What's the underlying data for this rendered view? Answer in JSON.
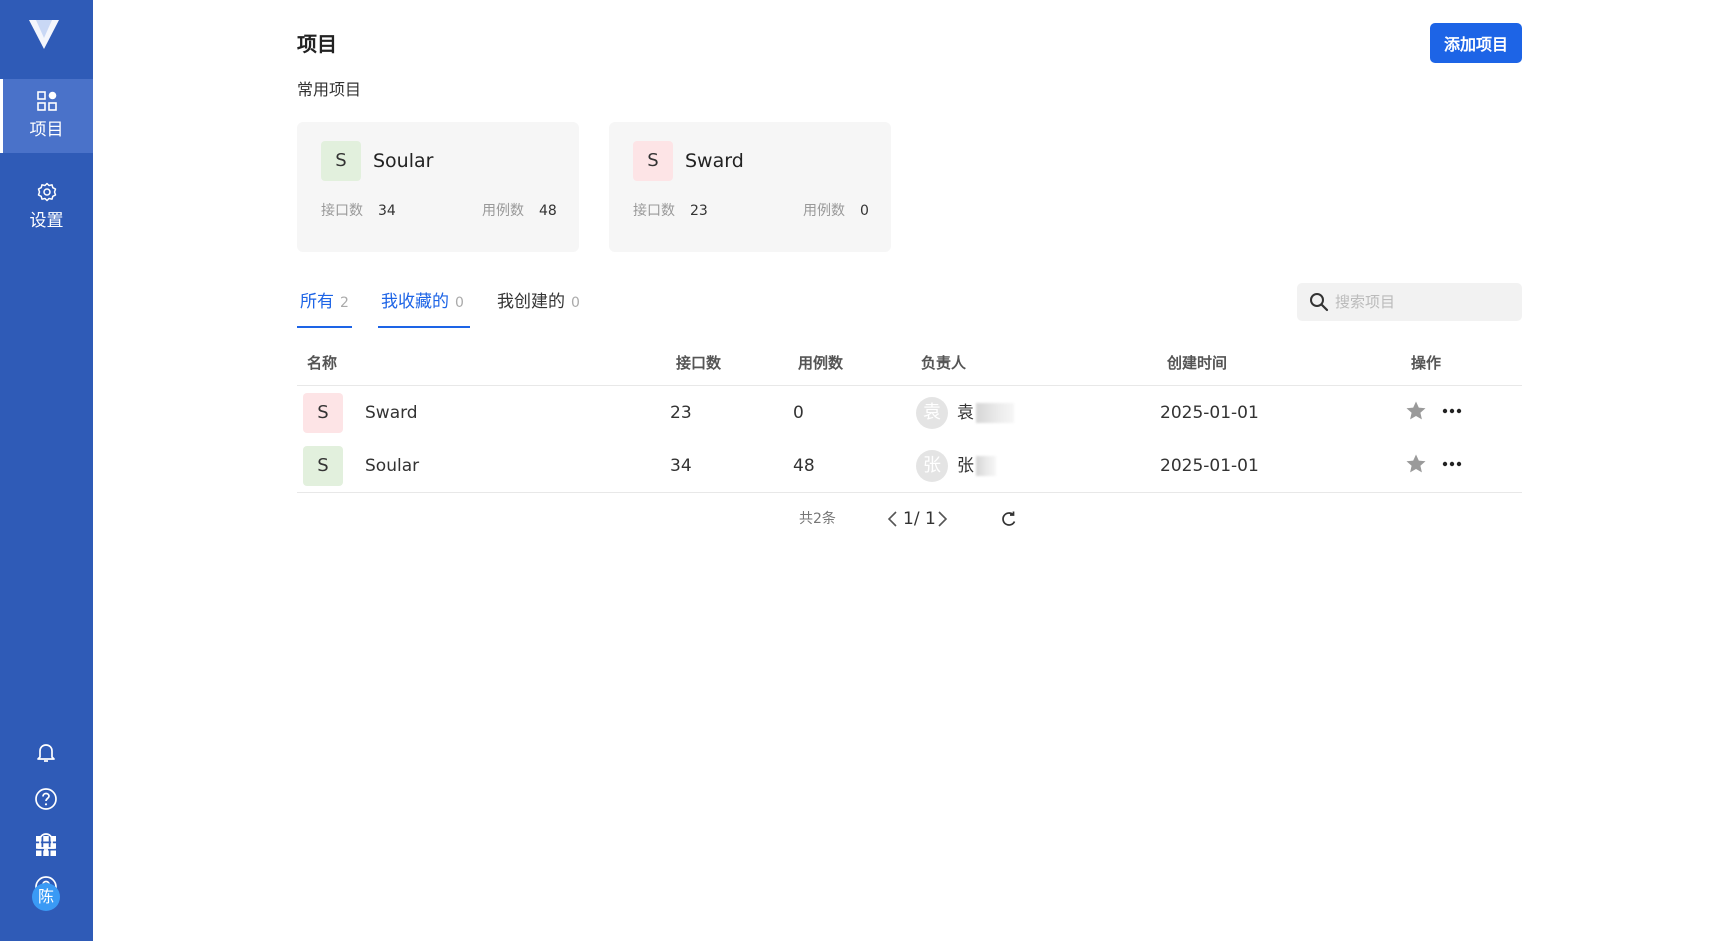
{
  "sidebar": {
    "nav": [
      {
        "label": "项目",
        "icon": "project-grid-icon",
        "active": true
      },
      {
        "label": "设置",
        "icon": "gear-icon",
        "active": false
      }
    ],
    "bottom_icons": [
      "bell-icon",
      "help-icon",
      "apps-grid-icon"
    ],
    "user_avatar": "陈",
    "colors": {
      "background": "#2f5bb7",
      "active": "#4a72c9"
    }
  },
  "header": {
    "title": "项目",
    "add_button": "添加项目"
  },
  "recent": {
    "label": "常用项目",
    "cards": [
      {
        "letter": "S",
        "name": "Soular",
        "api_label": "接口数",
        "api_count": "34",
        "case_label": "用例数",
        "case_count": "48",
        "badge_color": "#e2f0dd"
      },
      {
        "letter": "S",
        "name": "Sward",
        "api_label": "接口数",
        "api_count": "23",
        "case_label": "用例数",
        "case_count": "0",
        "badge_color": "#fde4e6"
      }
    ]
  },
  "tabs": [
    {
      "label": "所有",
      "count": "2",
      "active": true
    },
    {
      "label": "我收藏的",
      "count": "0",
      "active": true
    },
    {
      "label": "我创建的",
      "count": "0",
      "active": false
    }
  ],
  "search": {
    "placeholder": "搜索项目"
  },
  "table": {
    "headers": {
      "name": "名称",
      "apis": "接口数",
      "cases": "用例数",
      "owner": "负责人",
      "created": "创建时间",
      "actions": "操作"
    },
    "rows": [
      {
        "letter": "S",
        "name": "Sward",
        "apis": "23",
        "cases": "0",
        "owner_avatar": "袁",
        "owner": "袁",
        "created": "2025-01-01",
        "badge_color": "#fde4e6"
      },
      {
        "letter": "S",
        "name": "Soular",
        "apis": "34",
        "cases": "48",
        "owner_avatar": "张",
        "owner": "张",
        "created": "2025-01-01",
        "badge_color": "#e2f0dd"
      }
    ]
  },
  "pagination": {
    "total": "共2条",
    "page": "1/ 1"
  },
  "accent_color": "#1d64e6"
}
